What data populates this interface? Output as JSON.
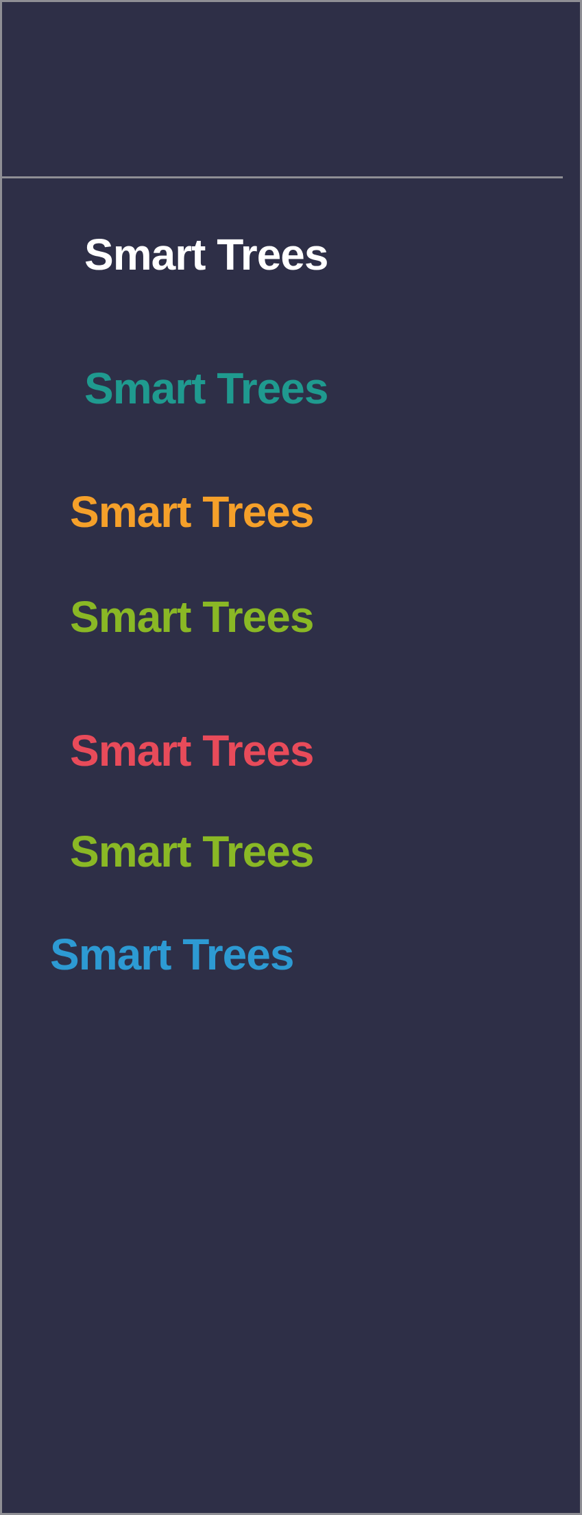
{
  "logos": [
    {
      "text": "Smart Trees",
      "color": "#ffffff"
    },
    {
      "text": "Smart Trees",
      "color": "#1f9a8f"
    },
    {
      "text": "Smart Trees",
      "color": "#f5a02a"
    },
    {
      "text": "Smart Trees",
      "color": "#8ab825"
    },
    {
      "text": "Smart Trees",
      "color": "#e84b5a"
    },
    {
      "text": "Smart Trees",
      "color": "#8ab825"
    },
    {
      "text": "Smart Trees",
      "color": "#2d9ad3"
    }
  ],
  "colors": {
    "background": "#2e2f47",
    "border": "#8f8f95"
  }
}
